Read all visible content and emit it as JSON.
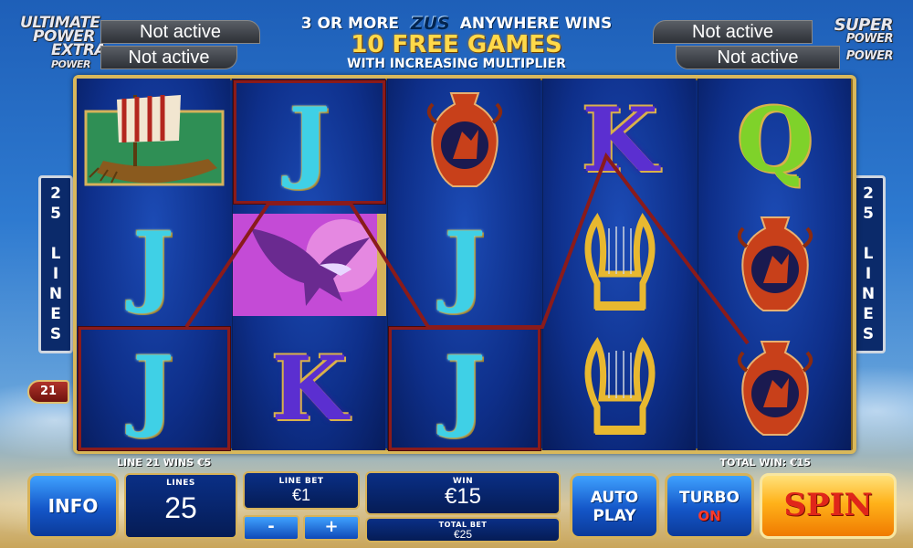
{
  "top": {
    "left_power": {
      "title_lines": [
        "ULTIMATE",
        "POWER",
        "EXTRA",
        "POWER"
      ],
      "status_1": "Not active",
      "status_2": "Not active"
    },
    "right_power": {
      "title_lines": [
        "SUPER",
        "POWER",
        "POWER"
      ],
      "status_1": "Not active",
      "status_2": "Not active"
    },
    "banner": {
      "line1_pre": "3 OR MORE",
      "line1_logo": "ZUS",
      "line1_post": "ANYWHERE WINS",
      "line2": "10 FREE GAMES",
      "line3": "WITH INCREASING MULTIPLIER"
    }
  },
  "reels": [
    [
      "ship",
      "J",
      "J"
    ],
    [
      "J",
      "eagle",
      "K"
    ],
    [
      "vase",
      "J",
      "J"
    ],
    [
      "K",
      "lyre",
      "lyre"
    ],
    [
      "Q",
      "vase",
      "vase"
    ]
  ],
  "side": {
    "left_lines": "25 LINES",
    "right_lines": "25 LINES",
    "marker": "21"
  },
  "status": {
    "line_win": "LINE 21 WINS €5",
    "total_win": "TOTAL WIN: €15"
  },
  "controls": {
    "info": "INFO",
    "lines_caption": "LINES",
    "lines_value": "25",
    "line_bet_caption": "LINE BET",
    "line_bet_value": "€1",
    "minus": "-",
    "plus": "+",
    "win_caption": "WIN",
    "win_value": "€15",
    "total_bet_caption": "TOTAL BET",
    "total_bet_value": "€25",
    "autoplay_1": "AUTO",
    "autoplay_2": "PLAY",
    "turbo_1": "TURBO",
    "turbo_2": "ON",
    "spin": "SPIN"
  },
  "colors": {
    "frame_gold": "#d9b85b",
    "payline": "#8a1b1b",
    "spin_text": "#e0261a"
  }
}
